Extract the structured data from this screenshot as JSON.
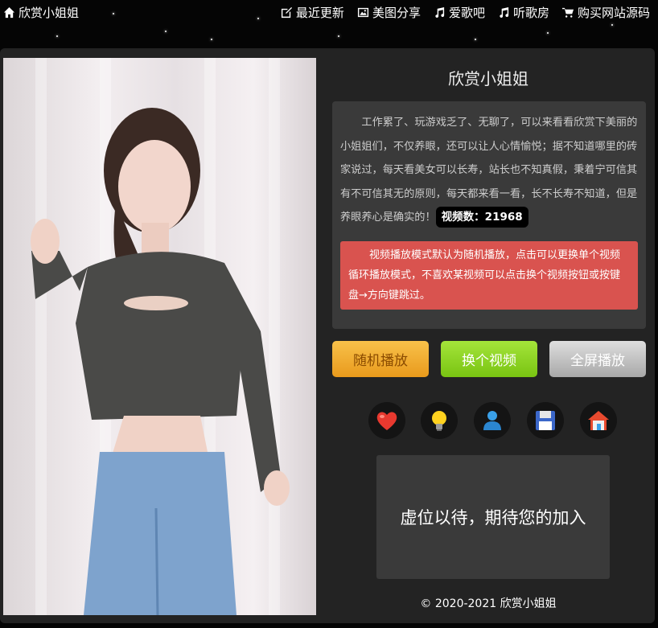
{
  "nav": {
    "brand": "欣赏小姐姐",
    "links": [
      "最近更新",
      "美图分享",
      "爱歌吧",
      "听歌房",
      "购买网站源码"
    ]
  },
  "site_title": "欣赏小姐姐",
  "intro": {
    "text": "工作累了、玩游戏乏了、无聊了，可以来看看欣赏下美丽的小姐姐们，不仅养眼，还可以让人心情愉悦；据不知道哪里的砖家说过，每天看美女可以长寿，站长也不知真假，秉着宁可信其有不可信其无的原则，每天都来看一看，长不长寿不知道，但是养眼养心是确实的！",
    "count_label": "视频数：21968"
  },
  "notice": "视频播放模式默认为随机播放，点击可以更换单个视频循环播放模式，不喜欢某视频可以点击换个视频按钮或按键盘→方向键跳过。",
  "buttons": {
    "random": "随机播放",
    "next": "换个视频",
    "fullscreen": "全屏播放"
  },
  "icons": [
    "heart-icon",
    "lightbulb-icon",
    "user-icon",
    "save-icon",
    "home-icon"
  ],
  "ad_text": "虚位以待，期待您的加入",
  "footer": "© 2020-2021 欣赏小姐姐",
  "colors": {
    "notice_bg": "#d9534f",
    "random_btn": "#f0ad2e",
    "next_btn": "#8fd626",
    "fullscreen_btn": "#c4c4c4"
  }
}
